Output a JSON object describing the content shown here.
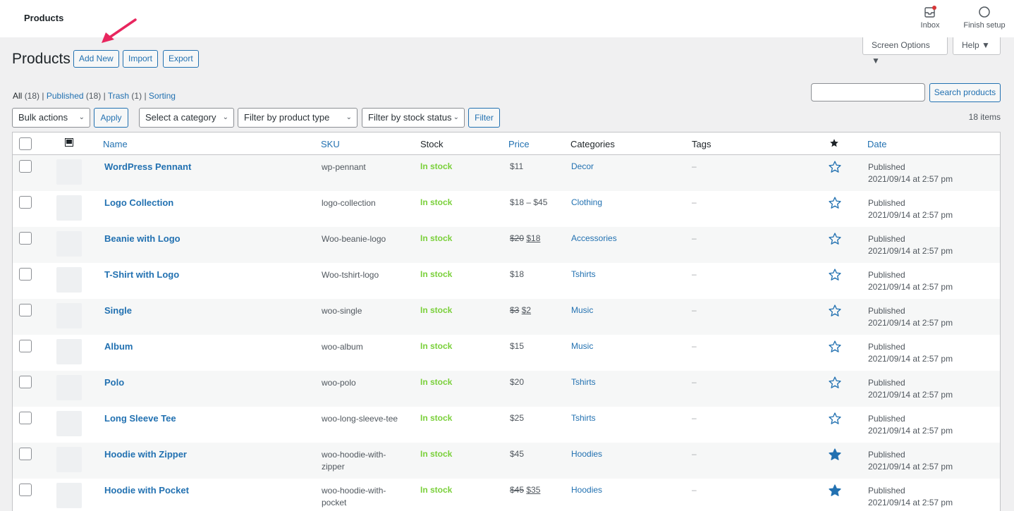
{
  "topbar": {
    "title": "Products",
    "inbox_label": "Inbox",
    "finish_label": "Finish setup"
  },
  "screen_meta": {
    "screen_options": "Screen Options ▼",
    "help": "Help ▼"
  },
  "page": {
    "heading": "Products",
    "add_new": "Add New",
    "import": "Import",
    "export": "Export"
  },
  "views": {
    "all": "All",
    "all_count": "(18)",
    "sep1": "|",
    "published": "Published",
    "published_count": "(18)",
    "sep2": "|",
    "trash": "Trash",
    "trash_count": "(1)",
    "sep3": "|",
    "sorting": "Sorting"
  },
  "search": {
    "value": "",
    "button": "Search products"
  },
  "filters": {
    "bulk": "Bulk actions",
    "apply": "Apply",
    "category": "Select a category",
    "type": "Filter by product type",
    "stock": "Filter by stock status",
    "filter": "Filter",
    "items": "18 items"
  },
  "columns": {
    "name": "Name",
    "sku": "SKU",
    "stock": "Stock",
    "price": "Price",
    "categories": "Categories",
    "tags": "Tags",
    "date": "Date"
  },
  "rows": [
    {
      "name": "WordPress Pennant",
      "sku": "wp-pennant",
      "sku2": "",
      "stock": "In stock",
      "price": "$11",
      "price_old": "",
      "price_new": "",
      "category": "Decor",
      "tags": "–",
      "status": "Published",
      "date": "2021/09/14 at 2:57 pm",
      "featured": false
    },
    {
      "name": "Logo Collection",
      "sku": "logo-collection",
      "sku2": "",
      "stock": "In stock",
      "price": "$18 – $45",
      "price_old": "",
      "price_new": "",
      "category": "Clothing",
      "tags": "–",
      "status": "Published",
      "date": "2021/09/14 at 2:57 pm",
      "featured": false
    },
    {
      "name": "Beanie with Logo",
      "sku": "Woo-beanie-logo",
      "sku2": "",
      "stock": "In stock",
      "price": "",
      "price_old": "$20",
      "price_new": "$18",
      "category": "Accessories",
      "tags": "–",
      "status": "Published",
      "date": "2021/09/14 at 2:57 pm",
      "featured": false
    },
    {
      "name": "T-Shirt with Logo",
      "sku": "Woo-tshirt-logo",
      "sku2": "",
      "stock": "In stock",
      "price": "$18",
      "price_old": "",
      "price_new": "",
      "category": "Tshirts",
      "tags": "–",
      "status": "Published",
      "date": "2021/09/14 at 2:57 pm",
      "featured": false
    },
    {
      "name": "Single",
      "sku": "woo-single",
      "sku2": "",
      "stock": "In stock",
      "price": "",
      "price_old": "$3",
      "price_new": "$2",
      "category": "Music",
      "tags": "–",
      "status": "Published",
      "date": "2021/09/14 at 2:57 pm",
      "featured": false
    },
    {
      "name": "Album",
      "sku": "woo-album",
      "sku2": "",
      "stock": "In stock",
      "price": "$15",
      "price_old": "",
      "price_new": "",
      "category": "Music",
      "tags": "–",
      "status": "Published",
      "date": "2021/09/14 at 2:57 pm",
      "featured": false
    },
    {
      "name": "Polo",
      "sku": "woo-polo",
      "sku2": "",
      "stock": "In stock",
      "price": "$20",
      "price_old": "",
      "price_new": "",
      "category": "Tshirts",
      "tags": "–",
      "status": "Published",
      "date": "2021/09/14 at 2:57 pm",
      "featured": false
    },
    {
      "name": "Long Sleeve Tee",
      "sku": "woo-long-sleeve-tee",
      "sku2": "",
      "stock": "In stock",
      "price": "$25",
      "price_old": "",
      "price_new": "",
      "category": "Tshirts",
      "tags": "–",
      "status": "Published",
      "date": "2021/09/14 at 2:57 pm",
      "featured": false
    },
    {
      "name": "Hoodie with Zipper",
      "sku": "woo-hoodie-with-",
      "sku2": "zipper",
      "stock": "In stock",
      "price": "$45",
      "price_old": "",
      "price_new": "",
      "category": "Hoodies",
      "tags": "–",
      "status": "Published",
      "date": "2021/09/14 at 2:57 pm",
      "featured": true
    },
    {
      "name": "Hoodie with Pocket",
      "sku": "woo-hoodie-with-",
      "sku2": "pocket",
      "stock": "In stock",
      "price": "",
      "price_old": "$45",
      "price_new": "$35",
      "category": "Hoodies",
      "tags": "–",
      "status": "Published",
      "date": "2021/09/14 at 2:57 pm",
      "featured": true
    }
  ],
  "colors": {
    "link": "#2271b1",
    "in_stock": "#7ad03a",
    "arrow": "#e8265e"
  }
}
